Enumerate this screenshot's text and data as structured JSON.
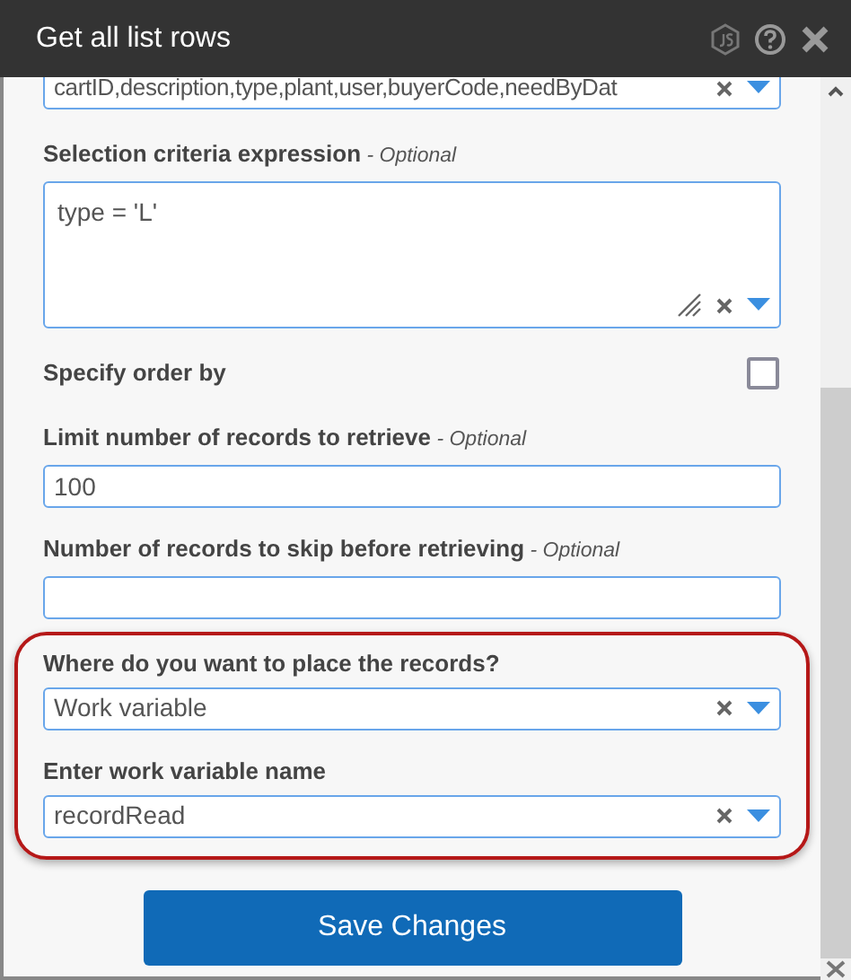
{
  "window": {
    "title": "Get all list rows"
  },
  "fields": [
    {
      "kind": "select",
      "value": "cartID,description,type,plant,user,buyerCode,needByDat"
    },
    {
      "kind": "textarea",
      "label": "Selection criteria expression",
      "optional": "- Optional",
      "value": "type = 'L'"
    },
    {
      "kind": "checkbox",
      "label": "Specify order by",
      "checked": false
    },
    {
      "kind": "text",
      "label": "Limit number of records to retrieve",
      "optional": "- Optional",
      "value": "100"
    },
    {
      "kind": "text",
      "label": "Number of records to skip before retrieving",
      "optional": "- Optional"
    }
  ],
  "highlighted_fields": [
    {
      "kind": "select",
      "label": "Where do you want to place the records?",
      "value": "Work variable"
    },
    {
      "kind": "select",
      "label": "Enter work variable name",
      "value": "recordRead"
    }
  ],
  "save_button": "Save Changes"
}
